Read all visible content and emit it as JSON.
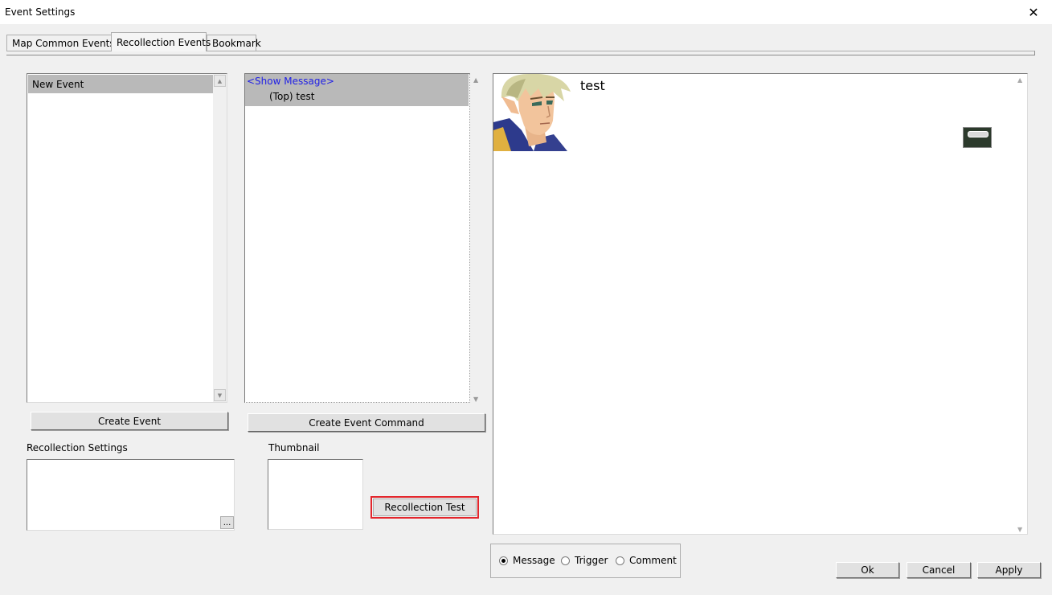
{
  "window": {
    "title": "Event Settings",
    "close_glyph": "✕"
  },
  "tabs": [
    {
      "label": "Map Common Events"
    },
    {
      "label": "Recollection Events"
    },
    {
      "label": "Bookmark"
    }
  ],
  "active_tab": "Recollection Events",
  "event_list": {
    "items": [
      {
        "label": "New Event",
        "selected": true
      }
    ]
  },
  "buttons": {
    "create_event": "Create Event",
    "create_event_command": "Create Event Command",
    "recollection_test": "Recollection Test",
    "ellipsis": "...",
    "ok": "Ok",
    "cancel": "Cancel",
    "apply": "Apply"
  },
  "command_list": {
    "command_label": "<Show Message>",
    "command_detail": "(Top) test"
  },
  "labels": {
    "recollection_settings": "Recollection Settings",
    "thumbnail": "Thumbnail"
  },
  "preview": {
    "message_text": "test",
    "face_icon": "character-portrait-icon"
  },
  "view_mode": {
    "options": [
      "Message",
      "Trigger",
      "Comment"
    ],
    "selected": "Message"
  },
  "colors": {
    "highlight": "#e3262c",
    "command_text": "#1e1ee6"
  }
}
